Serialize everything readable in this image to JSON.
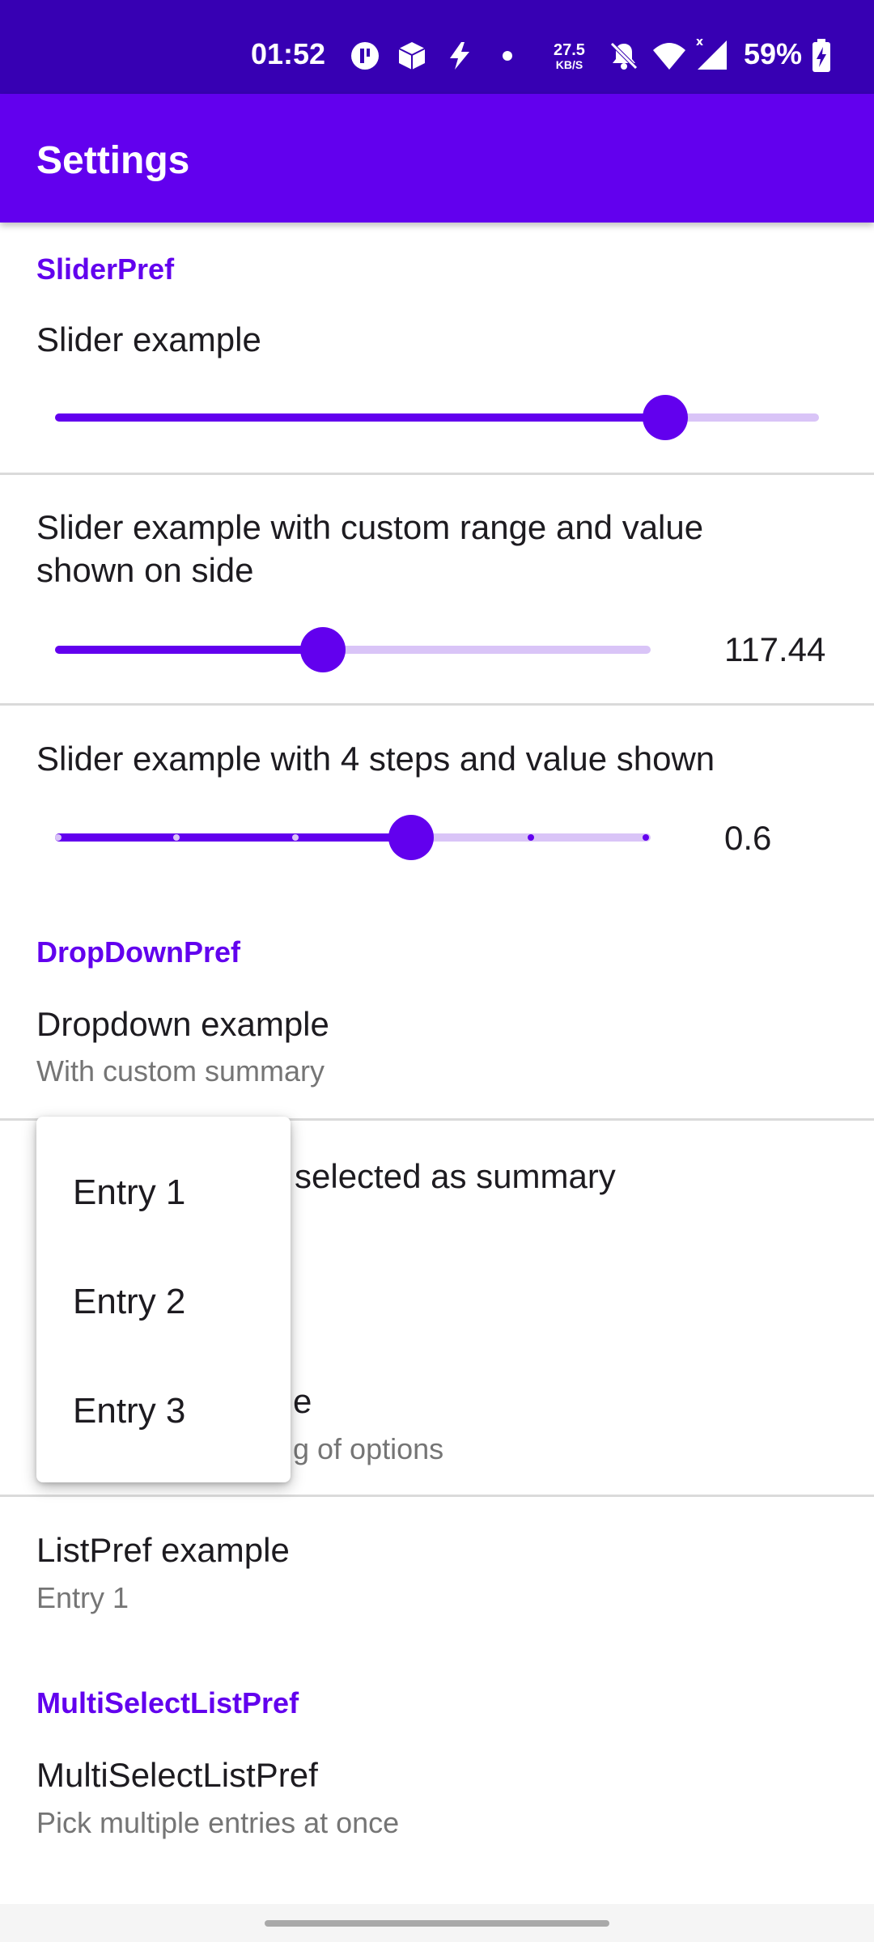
{
  "status_bar": {
    "time": "01:52",
    "net_speed_value": "27.5",
    "net_speed_unit": "KB/S",
    "battery": "59%",
    "icons": [
      "app-icon",
      "cube-icon",
      "bolt-icon",
      "dot-icon",
      "muted-bell-icon",
      "wifi-icon",
      "signal-icon",
      "battery-charging-icon"
    ]
  },
  "app_bar": {
    "title": "Settings"
  },
  "slider_pref": {
    "category": "SliderPref",
    "slider1": {
      "title": "Slider example",
      "value_fraction": 0.8
    },
    "slider2": {
      "title_line1": "Slider example with custom range and value",
      "title_line2": "shown on side",
      "value": "117.44",
      "value_fraction": 0.45
    },
    "slider3": {
      "title": "Slider example with 4 steps and value shown",
      "value": "0.6",
      "value_fraction": 0.6
    }
  },
  "dropdown_pref": {
    "category": "DropDownPref",
    "item1": {
      "title": "Dropdown example",
      "summary": "With custom summary"
    },
    "item2": {
      "title_visible": "selected as summary"
    },
    "item3": {
      "title_visible": "e",
      "summary_visible": "g of options"
    }
  },
  "dropdown_menu": {
    "entries": [
      "Entry 1",
      "Entry 2",
      "Entry 3"
    ]
  },
  "list_pref": {
    "title": "ListPref example",
    "summary": "Entry 1"
  },
  "multi_select": {
    "category": "MultiSelectListPref",
    "title": "MultiSelectListPref",
    "summary": "Pick multiple entries at once"
  },
  "colors": {
    "primary": "#6200ee",
    "primary_dark": "#3700b3",
    "track_inactive": "#d9c4f7"
  }
}
